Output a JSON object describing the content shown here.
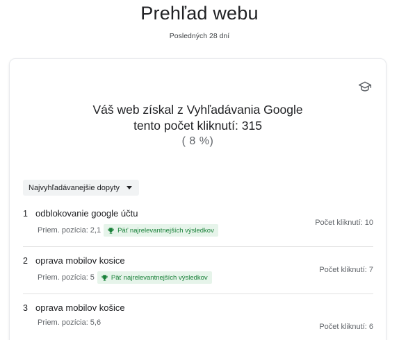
{
  "header": {
    "title": "Prehľad webu",
    "subtitle": "Posledných 28 dní"
  },
  "summary": {
    "icon": "school-icon",
    "headline_line1": "Váš web získal z Vyhľadávania Google",
    "headline_line2": "tento počet kliknutí: 315",
    "percent": "( 8 %)"
  },
  "dropdown": {
    "label": "Najvyhľadávanejšie dopyty",
    "icon": "caret-down-icon"
  },
  "queries": [
    {
      "index": "1",
      "query": "odblokovanie google účtu",
      "position_text": "Priem. pozícia: 2,1",
      "badge": "Päť najrelevantnejších výsledkov",
      "clicks_text": "Počet kliknutí: 10"
    },
    {
      "index": "2",
      "query": "oprava mobilov kosice",
      "position_text": "Priem. pozícia: 5",
      "badge": "Päť najrelevantnejších výsledkov",
      "clicks_text": "Počet kliknutí: 7"
    },
    {
      "index": "3",
      "query": "oprava mobilov košice",
      "position_text": "Priem. pozícia: 5,6",
      "badge": "",
      "clicks_text": "Počet kliknutí: 6"
    }
  ],
  "colors": {
    "badge_text": "#188038",
    "badge_bg": "#e6f4ea",
    "dropdown_bg": "#f1f3f4"
  }
}
